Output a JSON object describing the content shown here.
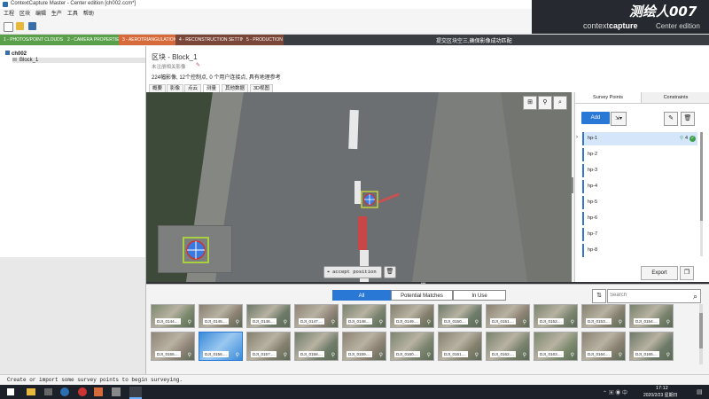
{
  "app": {
    "title": "ContextCapture Master - Center edition [ch002.ccm*]"
  },
  "menu": [
    "工程",
    "区块",
    "编辑",
    "生产",
    "工具",
    "帮助"
  ],
  "brand": {
    "watermark": "测绘人007",
    "name_prefix": "context",
    "name_bold": "capture",
    "edition": "Center edition"
  },
  "steps": [
    {
      "label": "1 - PHOTOS/POINT CLOUDS",
      "color": "#5aa04a"
    },
    {
      "label": "2 - CAMERA PROPERTIES",
      "color": "#5aa04a"
    },
    {
      "label": "3 - AEROTRIANGULATION",
      "color": "#d76a3a"
    },
    {
      "label": "4 - RECONSTRUCTION SETTINGS",
      "color": "#7a4638"
    },
    {
      "label": "5 - PRODUCTION",
      "color": "#7a4638"
    }
  ],
  "step_hint": "提交区块空三,确保影像成功匹配",
  "tree": {
    "project": "ch002",
    "block": "Block_1"
  },
  "block": {
    "title": "区块 - Block_1",
    "subtitle": "未注册相关影像",
    "summary": "224幅影像, 12个控制点, 0 个用户连接点, 具有地理参考",
    "tabs": [
      "概要",
      "影像",
      "点云",
      "测量",
      "其他数据",
      "3D视图"
    ]
  },
  "viewer": {
    "accept_label": "accept position"
  },
  "survey": {
    "tabs": [
      "Survey Points",
      "Constraints"
    ],
    "add_label": "Add",
    "points": [
      "hp-1",
      "hp-2",
      "hp-3",
      "hp-4",
      "hp-5",
      "hp-6",
      "hp-7",
      "hp-8"
    ],
    "selected_count": "4",
    "export_label": "Export"
  },
  "photos": {
    "filters": [
      "All",
      "Potential Matches",
      "In Use"
    ],
    "search_placeholder": "Search",
    "row1": [
      "DJI_0144....",
      "DJI_0145....",
      "DJI_0146....",
      "DJI_0147....",
      "DJI_0148....",
      "DJI_0149....",
      "DJI_0150....",
      "DJI_0151....",
      "DJI_0152....",
      "DJI_0153....",
      "DJI_0154...."
    ],
    "row2": [
      "DJI_0155....",
      "DJI_0156....",
      "DJI_0157....",
      "DJI_0158....",
      "DJI_0159....",
      "DJI_0160....",
      "DJI_0161....",
      "DJI_0162....",
      "DJI_0163....",
      "DJI_0164....",
      "DJI_0165...."
    ]
  },
  "status": {
    "message": "Create or import some survey points to begin surveying."
  },
  "taskbar": {
    "time": "17:12",
    "date": "2020/2/23 星期日"
  }
}
